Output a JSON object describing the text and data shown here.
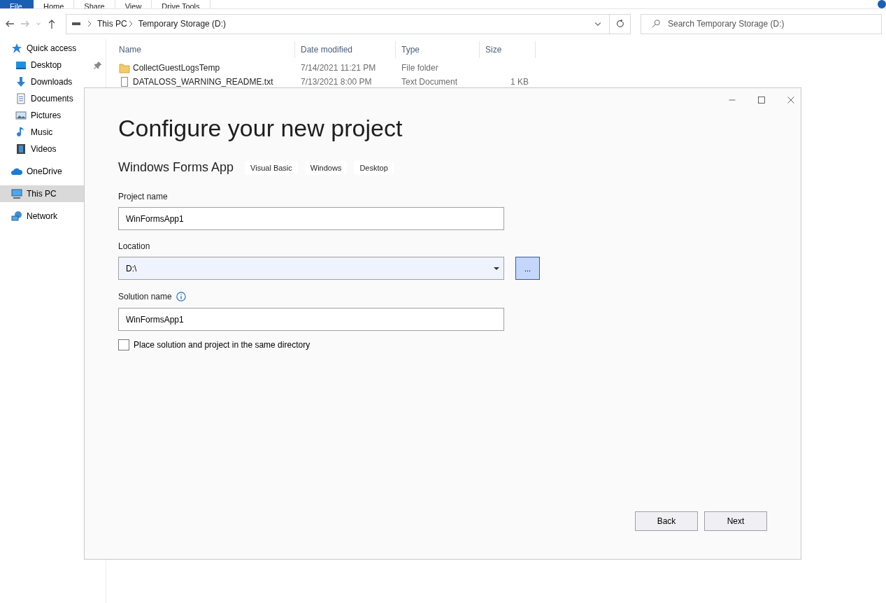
{
  "explorer": {
    "ribbon_tabs": [
      {
        "label": "File",
        "selected": true
      },
      {
        "label": "Home",
        "selected": false
      },
      {
        "label": "Share",
        "selected": false
      },
      {
        "label": "View",
        "selected": false
      },
      {
        "label": "Drive Tools",
        "selected": false
      }
    ],
    "path": [
      "This PC",
      "Temporary Storage (D:)"
    ],
    "search": {
      "placeholder": "Search Temporary Storage (D:)"
    },
    "sidebar": {
      "items": [
        {
          "label": "Quick access",
          "selected": false,
          "children": [
            {
              "label": "Desktop",
              "pinned": true,
              "selected": false
            },
            {
              "label": "Downloads",
              "pinned": false,
              "selected": false
            },
            {
              "label": "Documents",
              "selected": false
            },
            {
              "label": "Pictures",
              "selected": false
            },
            {
              "label": "Music",
              "selected": false
            },
            {
              "label": "Videos",
              "selected": false
            }
          ]
        },
        {
          "label": "OneDrive",
          "selected": false
        },
        {
          "label": "This PC",
          "selected": true
        },
        {
          "label": "Network",
          "selected": false
        }
      ]
    },
    "table": {
      "columns": [
        "Name",
        "Date modified",
        "Type",
        "Size"
      ],
      "rows": [
        {
          "kind": "folder",
          "cells": [
            "CollectGuestLogsTemp",
            "7/14/2021 11:21 PM",
            "File folder",
            ""
          ]
        },
        {
          "kind": "file",
          "cells": [
            "DATALOSS_WARNING_README.txt",
            "7/13/2021 8:00 PM",
            "Text Document",
            "1 KB"
          ]
        }
      ]
    }
  },
  "dialog": {
    "title": "Configure your new project",
    "template": "Windows Forms App",
    "tags": [
      "Visual Basic",
      "Windows",
      "Desktop"
    ],
    "fields": [
      {
        "kind": "text",
        "label": "Project name",
        "value": "WinFormsApp1",
        "info": false
      },
      {
        "kind": "dropdown",
        "label": "Location",
        "value": "D:\\",
        "browse": "...",
        "info": false
      },
      {
        "kind": "text",
        "label": "Solution name",
        "value": "WinFormsApp1",
        "info": true
      }
    ],
    "checkbox": {
      "label": "Place solution and project in the same directory",
      "checked": false
    },
    "buttons": [
      "Back",
      "Next"
    ]
  }
}
